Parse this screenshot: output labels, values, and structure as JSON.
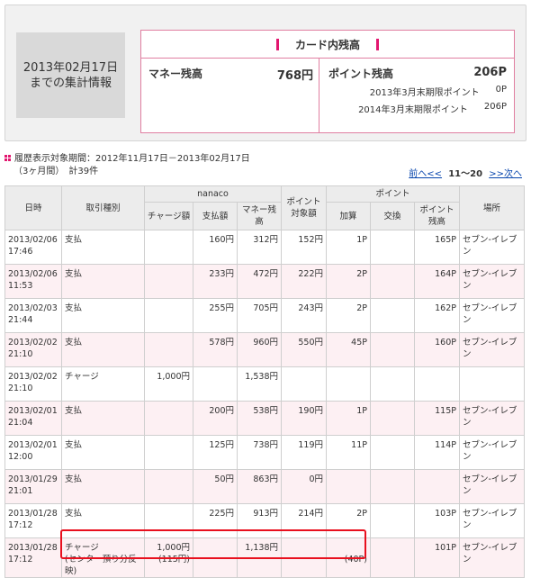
{
  "summary": {
    "date": "2013年02月17日",
    "date_caption": "までの集計情報",
    "title": "カード内残高",
    "money_label": "マネー残高",
    "money_value": "768円",
    "points_label": "ポイント残高",
    "points_value": "206P",
    "expiry": [
      {
        "label": "2013年3月末期限ポイント",
        "value": "0P"
      },
      {
        "label": "2014年3月末期限ポイント",
        "value": "206P"
      }
    ]
  },
  "period": {
    "label": "履歴表示対象期間：2012年11月17日－2013年02月17日",
    "sub": "（3ヶ月間）　計39件"
  },
  "pager": {
    "prev": "前へ<<",
    "range": "11～20",
    "next": ">>次へ"
  },
  "table": {
    "headers": {
      "datetime": "日時",
      "type": "取引種別",
      "nanaco": "nanaco",
      "charge": "チャージ額",
      "paid": "支払額",
      "money_balance": "マネー残高",
      "point_target": "ポイント対象額",
      "point": "ポイント",
      "add": "加算",
      "exchange": "交換",
      "point_balance": "ポイント残高",
      "place": "場所"
    },
    "rows": [
      {
        "date": "2013/02/06",
        "time": "17:46",
        "type": "支払",
        "charge": "",
        "paid": "160円",
        "balance": "312円",
        "target": "152円",
        "add": "1P",
        "exchange": "",
        "pbal": "165P",
        "place": "セブン-イレブン"
      },
      {
        "date": "2013/02/06",
        "time": "11:53",
        "type": "支払",
        "charge": "",
        "paid": "233円",
        "balance": "472円",
        "target": "222円",
        "add": "2P",
        "exchange": "",
        "pbal": "164P",
        "place": "セブン-イレブン"
      },
      {
        "date": "2013/02/03",
        "time": "21:44",
        "type": "支払",
        "charge": "",
        "paid": "255円",
        "balance": "705円",
        "target": "243円",
        "add": "2P",
        "exchange": "",
        "pbal": "162P",
        "place": "セブン-イレブン"
      },
      {
        "date": "2013/02/02",
        "time": "21:10",
        "type": "支払",
        "charge": "",
        "paid": "578円",
        "balance": "960円",
        "target": "550円",
        "add": "45P",
        "exchange": "",
        "pbal": "160P",
        "place": "セブン-イレブン"
      },
      {
        "date": "2013/02/02",
        "time": "21:10",
        "type": "チャージ",
        "charge": "1,000円",
        "paid": "",
        "balance": "1,538円",
        "target": "",
        "add": "",
        "exchange": "",
        "pbal": "",
        "place": ""
      },
      {
        "date": "2013/02/01",
        "time": "21:04",
        "type": "支払",
        "charge": "",
        "paid": "200円",
        "balance": "538円",
        "target": "190円",
        "add": "1P",
        "exchange": "",
        "pbal": "115P",
        "place": "セブン-イレブン"
      },
      {
        "date": "2013/02/01",
        "time": "12:00",
        "type": "支払",
        "charge": "",
        "paid": "125円",
        "balance": "738円",
        "target": "119円",
        "add": "11P",
        "exchange": "",
        "pbal": "114P",
        "place": "セブン-イレブン"
      },
      {
        "date": "2013/01/29",
        "time": "21:01",
        "type": "支払",
        "charge": "",
        "paid": "50円",
        "balance": "863円",
        "target": "0円",
        "add": "",
        "exchange": "",
        "pbal": "",
        "place": "セブン-イレブン"
      },
      {
        "date": "2013/01/28",
        "time": "17:12",
        "type": "支払",
        "charge": "",
        "paid": "225円",
        "balance": "913円",
        "target": "214円",
        "add": "2P",
        "exchange": "",
        "pbal": "103P",
        "place": "セブン-イレブン"
      },
      {
        "date": "2013/01/28",
        "time": "17:12",
        "type": "チャージ",
        "charge": "1,000円",
        "paid": "",
        "balance": "1,138円",
        "target": "",
        "add": "",
        "exchange": "",
        "pbal": "101P",
        "place": "セブン-イレブン",
        "note": "(センター預り分反映)",
        "note_charge": "(115円)",
        "note_add": "(40P)"
      }
    ]
  }
}
